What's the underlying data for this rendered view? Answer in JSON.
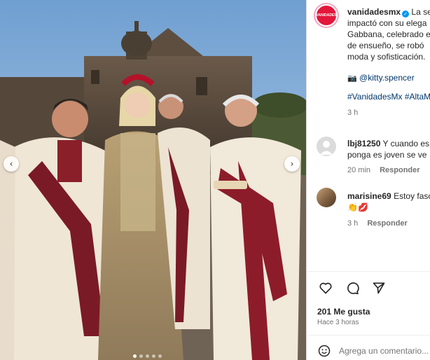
{
  "post": {
    "username": "vanidadesmx",
    "avatar_text": "VANIDADES",
    "caption_lines": [
      "La se",
      "impactó con su elega",
      "Gabbana, celebrado e",
      "de ensueño, se robó",
      "moda y sofisticación."
    ],
    "mention_icon": "camera-icon",
    "mention": "@kitty.spencer",
    "hashtags": "#VanidadesMx #AltaM",
    "time": "3 h"
  },
  "comments": [
    {
      "username": "lbj81250",
      "text_line1": "Y cuando es",
      "text_line2": "ponga es joven se ve",
      "time": "20 min",
      "reply": "Responder"
    },
    {
      "username": "marisine69",
      "text_line1": "Estoy fasc",
      "emojis": "👏💋",
      "time": "3 h",
      "reply": "Responder"
    }
  ],
  "stats": {
    "likes": "201 Me gusta",
    "posted": "Hace 3 horas"
  },
  "comment_input": {
    "placeholder": "Agrega un comentario..."
  },
  "carousel": {
    "prev": "‹",
    "next": "›"
  },
  "colors": {
    "brand": "#e3173b",
    "link": "#00376b",
    "verified": "#0095f6"
  }
}
